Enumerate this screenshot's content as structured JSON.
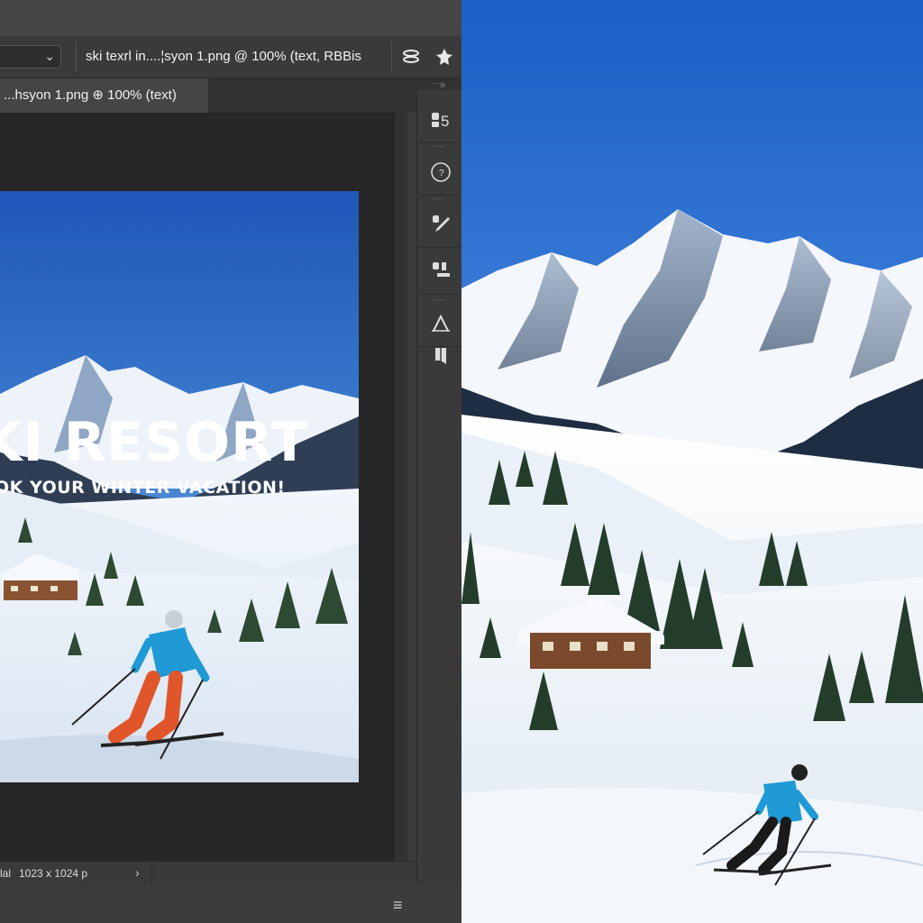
{
  "options_bar": {
    "document_title": "ski texrl in....¦syon 1.png @ 100% (text, RBBis"
  },
  "tab": {
    "label": "...hsyon 1.png ⊕ 100% (text)"
  },
  "poster": {
    "title": "KI RESORT",
    "subtitle": "OK YOUR WINTER VACATION!"
  },
  "status_bar": {
    "zoom_label": "lal",
    "dimensions": "1023 x 1024 p"
  },
  "panel": {
    "history_label": "5"
  },
  "colors": {
    "accent_sky": "#2f6fd1",
    "jacket": "#1f9ad6",
    "pants": "#e0562a",
    "ui_dark": "#262626"
  },
  "icons": [
    "chevron-down-icon",
    "brush-settings-icon",
    "puppet-icon",
    "history-icon",
    "info-icon",
    "brush-icon",
    "clone-stamp-icon",
    "type-icon",
    "paragraph-icon",
    "chevron-right-icon",
    "menu-icon"
  ]
}
